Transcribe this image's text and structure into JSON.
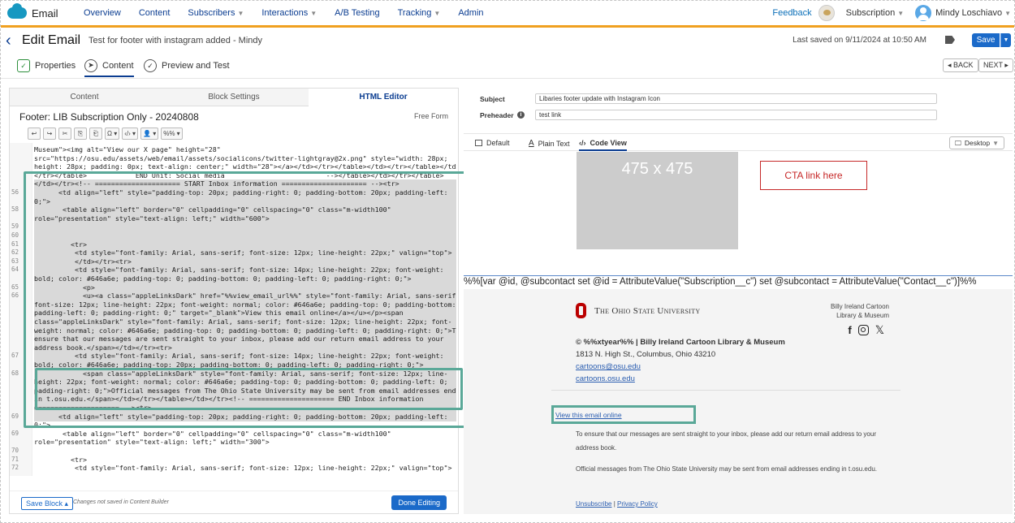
{
  "topnav": {
    "brand": "Email",
    "items": [
      "Overview",
      "Content",
      "Subscribers",
      "Interactions",
      "A/B Testing",
      "Tracking",
      "Admin"
    ],
    "feedback": "Feedback",
    "subscription": "Subscription",
    "user": "Mindy Loschiavo"
  },
  "titlebar": {
    "title": "Edit Email",
    "subtitle": "Test for footer with instagram added - Mindy",
    "last_saved": "Last saved on 9/11/2024 at 10:50 AM",
    "save": "Save"
  },
  "modes": {
    "properties": "Properties",
    "content": "Content",
    "preview": "Preview and Test",
    "back": "◂ BACK",
    "next": "NEXT ▸"
  },
  "left": {
    "tabs": [
      "Content",
      "Block Settings",
      "HTML Editor"
    ],
    "block_name": "Footer: LIB Subscription Only - 20240808",
    "mode_label": "Free Form",
    "toolbar": [
      "↩",
      "↪",
      "✂",
      "⎘",
      "⎗",
      "Ω ▾",
      "‹/› ▾",
      "👤 ▾",
      "%% ▾"
    ],
    "code_lines": [
      {
        "n": "",
        "t": "Museum\"><img alt=\"View our X page\" height=\"28\""
      },
      {
        "n": "",
        "t": "src=\"https://osu.edu/assets/web/email/assets/socialicons/twitter-lightgray@2x.png\" style=\"width: 28px;"
      },
      {
        "n": "",
        "t": "height: 28px; padding: 0px; text-align: center;\" width=\"28\"></a></td></tr></table></td></tr></table></td>"
      },
      {
        "n": "",
        "t": "</tr></table>            END Unit: Social media                         --></table></td></tr></table>"
      },
      {
        "n": "",
        "t": "</td></tr><!-- ===================== START Inbox information ===================== --><tr>"
      },
      {
        "n": "56",
        "t": "      <td align=\"left\" style=\"padding-top: 20px; padding-right: 0; padding-bottom: 20px; padding-left:"
      },
      {
        "n": "",
        "t": "0;\">"
      },
      {
        "n": "58",
        "t": "       <table align=\"left\" border=\"0\" cellpadding=\"0\" cellspacing=\"0\" class=\"m-width100\""
      },
      {
        "n": "",
        "t": "role=\"presentation\" style=\"text-align: left;\" width=\"600\">"
      },
      {
        "n": "59",
        "t": ""
      },
      {
        "n": "60",
        "t": ""
      },
      {
        "n": "61",
        "t": "         <tr>"
      },
      {
        "n": "62",
        "t": "          <td style=\"font-family: Arial, sans-serif; font-size: 12px; line-height: 22px;\" valign=\"top\">"
      },
      {
        "n": "63",
        "t": "          </td></tr><tr>"
      },
      {
        "n": "64",
        "t": "          <td style=\"font-family: Arial, sans-serif; font-size: 14px; line-height: 22px; font-weight:"
      },
      {
        "n": "",
        "t": "bold; color: #646a6e; padding-top: 0; padding-bottom: 0; padding-left: 0; padding-right: 0;\">"
      },
      {
        "n": "65",
        "t": "            <p>"
      },
      {
        "n": "66",
        "t": "            <u><a class=\"appleLinksDark\" href=\"%%view_email_url%%\" style=\"font-family: Arial, sans-serif;"
      },
      {
        "n": "",
        "t": "font-size: 12px; line-height: 22px; font-weight: normal; color: #646a6e; padding-top: 0; padding-bottom: 0;"
      },
      {
        "n": "",
        "t": "padding-left: 0; padding-right: 0;\" target=\"_blank\">View this email online</a></u></p><span"
      },
      {
        "n": "",
        "t": "class=\"appleLinksDark\" style=\"font-family: Arial, sans-serif; font-size: 12px; line-height: 22px; font-"
      },
      {
        "n": "",
        "t": "weight: normal; color: #646a6e; padding-top: 0; padding-bottom: 0; padding-left: 0; padding-right: 0;\">To"
      },
      {
        "n": "",
        "t": "ensure that our messages are sent straight to your inbox, please add our return email address to your"
      },
      {
        "n": "",
        "t": "address book.</span></td></tr><tr>"
      },
      {
        "n": "67",
        "t": "          <td style=\"font-family: Arial, sans-serif; font-size: 14px; line-height: 22px; font-weight:"
      },
      {
        "n": "",
        "t": "bold; color: #646a6e; padding-top: 20px; padding-bottom: 0; padding-left: 0; padding-right: 0;\">"
      },
      {
        "n": "68",
        "t": "            <span class=\"appleLinksDark\" style=\"font-family: Arial, sans-serif; font-size: 12px; line-"
      },
      {
        "n": "",
        "t": "height: 22px; font-weight: normal; color: #646a6e; padding-top: 0; padding-bottom: 0; padding-left: 0;"
      },
      {
        "n": "",
        "t": "padding-right: 0;\">Official messages from The Ohio State University may be sent from email addresses ending"
      },
      {
        "n": "",
        "t": "in t.osu.edu.</span></td></tr></table></td></tr><!-- ===================== END Inbox information"
      },
      {
        "n": "",
        "t": "===================== --><tr>"
      },
      {
        "n": "69",
        "t": "      <td align=\"left\" style=\"padding-top: 20px; padding-right: 0; padding-bottom: 20px; padding-left:"
      },
      {
        "n": "",
        "t": "0;\">"
      },
      {
        "n": "69",
        "t": "       <table align=\"left\" border=\"0\" cellpadding=\"0\" cellspacing=\"0\" class=\"m-width100\""
      },
      {
        "n": "",
        "t": "role=\"presentation\" style=\"text-align: left;\" width=\"300\">"
      },
      {
        "n": "70",
        "t": ""
      },
      {
        "n": "71",
        "t": "         <tr>"
      },
      {
        "n": "72",
        "t": "          <td style=\"font-family: Arial, sans-serif; font-size: 12px; line-height: 22px;\" valign=\"top\">"
      }
    ],
    "save_block": "Save Block ▴",
    "not_saved": "Changes not saved in Content Builder",
    "done": "Done Editing"
  },
  "right": {
    "subject_label": "Subject",
    "subject_value": "Libaries footer update with Instagram Icon",
    "preheader_label": "Preheader",
    "preheader_value": "test link",
    "tabs": [
      "Default",
      "Plain Text",
      "Code View"
    ],
    "device": "Desktop",
    "placeholder": "475 x 475",
    "cta": "CTA link here",
    "ampscript": "%%[var @id, @subcontact set @id = AttributeValue(\"Subscription__c\") set @subcontact = AttributeValue(\"Contact__c\")]%%",
    "osu_name": "The Ohio State University",
    "library_line1": "Billy Ireland Cartoon",
    "library_line2": "Library & Museum",
    "copyright": "© %%xtyear%% | Billy Ireland Cartoon Library & Museum",
    "address": "1813 N. High St., Columbus, Ohio 43210",
    "email_link": "cartoons@osu.edu",
    "web_link": "cartoons.osu.edu",
    "view_online": "View this email online",
    "ensure": "To ensure that our messages are sent straight to your inbox, please add our return email address to your address book.",
    "official": "Official messages from The Ohio State University may be sent from email addresses ending in t.osu.edu.",
    "unsubscribe": "Unsubscribe",
    "separator": " | ",
    "privacy": "Privacy Policy"
  },
  "colors": {
    "accent": "#f0a020",
    "primary": "#1b6ac9",
    "highlight": "#5aa898",
    "osu_red": "#bb0000"
  }
}
